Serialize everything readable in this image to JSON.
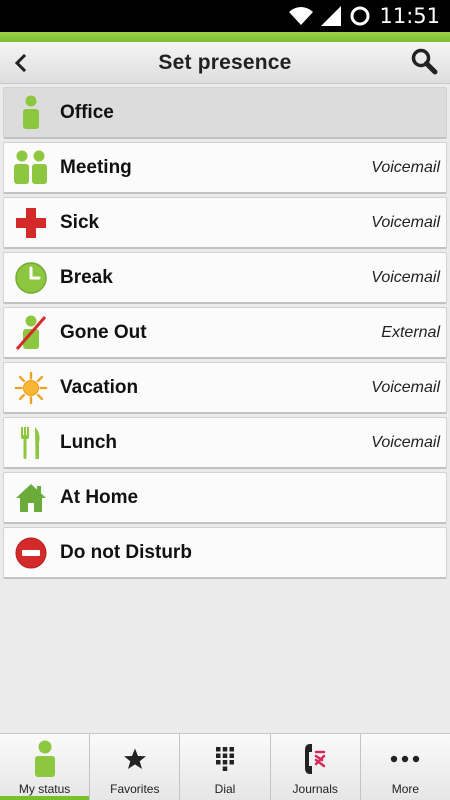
{
  "status_bar": {
    "time": "11:51"
  },
  "header": {
    "title": "Set presence"
  },
  "presence_items": [
    {
      "label": "Office",
      "forward": "",
      "icon": "person-icon",
      "selected": true
    },
    {
      "label": "Meeting",
      "forward": "Voicemail",
      "icon": "meeting-icon"
    },
    {
      "label": "Sick",
      "forward": "Voicemail",
      "icon": "red-cross-icon"
    },
    {
      "label": "Break",
      "forward": "Voicemail",
      "icon": "clock-icon"
    },
    {
      "label": "Gone Out",
      "forward": "External",
      "icon": "person-crossed-icon"
    },
    {
      "label": "Vacation",
      "forward": "Voicemail",
      "icon": "sun-icon"
    },
    {
      "label": "Lunch",
      "forward": "Voicemail",
      "icon": "fork-knife-icon"
    },
    {
      "label": "At Home",
      "forward": "",
      "icon": "house-icon"
    },
    {
      "label": "Do not Disturb",
      "forward": "",
      "icon": "do-not-disturb-icon"
    }
  ],
  "bottom_nav": [
    {
      "label": "My status",
      "icon": "person-icon",
      "active": true
    },
    {
      "label": "Favorites",
      "icon": "star-icon"
    },
    {
      "label": "Dial",
      "icon": "dialpad-icon"
    },
    {
      "label": "Journals",
      "icon": "phone-journal-icon"
    },
    {
      "label": "More",
      "icon": "more-dots-icon"
    }
  ],
  "colors": {
    "accent_green": "#7cbf2d",
    "red": "#d42a2a"
  }
}
